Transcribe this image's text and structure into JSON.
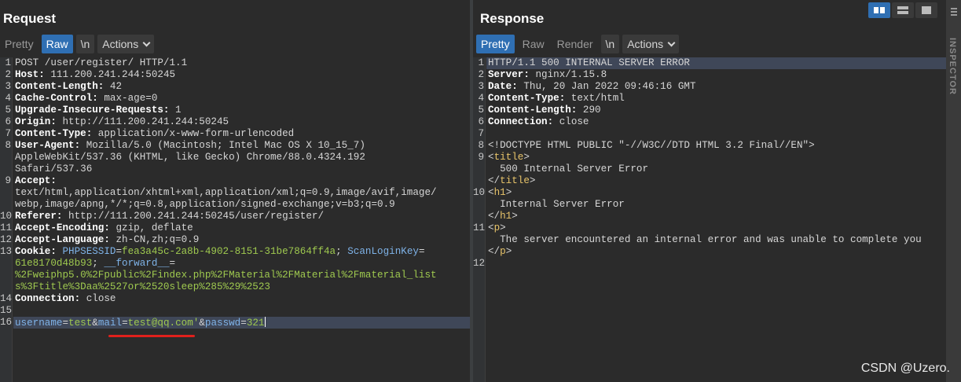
{
  "request": {
    "title": "Request",
    "toolbar": {
      "pretty": "Pretty",
      "raw": "Raw",
      "newline": "\\n",
      "actions": "Actions"
    },
    "lines": [
      {
        "n": "1",
        "segments": [
          {
            "t": "POST /user/register/ HTTP/1.1",
            "c": "v"
          }
        ]
      },
      {
        "n": "2",
        "segments": [
          {
            "t": "Host:",
            "c": "k"
          },
          {
            "t": " 111.200.241.244:50245",
            "c": "v"
          }
        ]
      },
      {
        "n": "3",
        "segments": [
          {
            "t": "Content-Length:",
            "c": "k"
          },
          {
            "t": " 42",
            "c": "v"
          }
        ]
      },
      {
        "n": "4",
        "segments": [
          {
            "t": "Cache-Control:",
            "c": "k"
          },
          {
            "t": " max-age=0",
            "c": "v"
          }
        ]
      },
      {
        "n": "5",
        "segments": [
          {
            "t": "Upgrade-Insecure-Requests:",
            "c": "k"
          },
          {
            "t": " 1",
            "c": "v"
          }
        ]
      },
      {
        "n": "6",
        "segments": [
          {
            "t": "Origin:",
            "c": "k"
          },
          {
            "t": " http://111.200.241.244:50245",
            "c": "v"
          }
        ]
      },
      {
        "n": "7",
        "segments": [
          {
            "t": "Content-Type:",
            "c": "k"
          },
          {
            "t": " application/x-www-form-urlencoded",
            "c": "v"
          }
        ]
      },
      {
        "n": "8",
        "segments": [
          {
            "t": "User-Agent:",
            "c": "k"
          },
          {
            "t": " Mozilla/5.0 (Macintosh; Intel Mac OS X 10_15_7)",
            "c": "v"
          }
        ]
      },
      {
        "n": "",
        "segments": [
          {
            "t": "AppleWebKit/537.36 (KHTML, like Gecko) Chrome/88.0.4324.192",
            "c": "v"
          }
        ]
      },
      {
        "n": "",
        "segments": [
          {
            "t": "Safari/537.36",
            "c": "v"
          }
        ]
      },
      {
        "n": "9",
        "segments": [
          {
            "t": "Accept:",
            "c": "k"
          }
        ]
      },
      {
        "n": "",
        "segments": [
          {
            "t": "text/html,application/xhtml+xml,application/xml;q=0.9,image/avif,image/",
            "c": "v"
          }
        ]
      },
      {
        "n": "",
        "segments": [
          {
            "t": "webp,image/apng,*/*;q=0.8,application/signed-exchange;v=b3;q=0.9",
            "c": "v"
          }
        ]
      },
      {
        "n": "10",
        "segments": [
          {
            "t": "Referer:",
            "c": "k"
          },
          {
            "t": " http://111.200.241.244:50245/user/register/",
            "c": "v"
          }
        ]
      },
      {
        "n": "11",
        "segments": [
          {
            "t": "Accept-Encoding:",
            "c": "k"
          },
          {
            "t": " gzip, deflate",
            "c": "v"
          }
        ]
      },
      {
        "n": "12",
        "segments": [
          {
            "t": "Accept-Language:",
            "c": "k"
          },
          {
            "t": " zh-CN,zh;q=0.9",
            "c": "v"
          }
        ]
      },
      {
        "n": "13",
        "segments": [
          {
            "t": "Cookie:",
            "c": "k"
          },
          {
            "t": " PHPSESSID",
            "c": "b"
          },
          {
            "t": "=",
            "c": "v"
          },
          {
            "t": "fea3a45c-2a8b-4902-8151-31be7864ff4a",
            "c": "g"
          },
          {
            "t": "; ",
            "c": "v"
          },
          {
            "t": "ScanLoginKey",
            "c": "b"
          },
          {
            "t": "=",
            "c": "v"
          }
        ]
      },
      {
        "n": "",
        "segments": [
          {
            "t": "61e8170d48b93",
            "c": "g"
          },
          {
            "t": "; ",
            "c": "v"
          },
          {
            "t": "__forward__",
            "c": "b"
          },
          {
            "t": "=",
            "c": "v"
          }
        ]
      },
      {
        "n": "",
        "segments": [
          {
            "t": "%2Fweiphp5.0%2Fpublic%2Findex.php%2FMaterial%2FMaterial%2Fmaterial_list",
            "c": "g"
          }
        ]
      },
      {
        "n": "",
        "segments": [
          {
            "t": "s%3Ftitle%3Daa%2527or%2520sleep%285%29%2523",
            "c": "g"
          }
        ]
      },
      {
        "n": "14",
        "segments": [
          {
            "t": "Connection:",
            "c": "k"
          },
          {
            "t": " close",
            "c": "v"
          }
        ]
      },
      {
        "n": "15",
        "segments": []
      },
      {
        "n": "16",
        "segments": [
          {
            "t": "username",
            "c": "b"
          },
          {
            "t": "=",
            "c": "v"
          },
          {
            "t": "test",
            "c": "g"
          },
          {
            "t": "&",
            "c": "v"
          },
          {
            "t": "mail",
            "c": "b"
          },
          {
            "t": "=",
            "c": "v"
          },
          {
            "t": "test@qq.com'",
            "c": "g"
          },
          {
            "t": "&",
            "c": "v"
          },
          {
            "t": "passwd",
            "c": "b"
          },
          {
            "t": "=",
            "c": "v"
          },
          {
            "t": "321",
            "c": "g"
          }
        ],
        "highlight": true,
        "cursor": true
      }
    ]
  },
  "response": {
    "title": "Response",
    "toolbar": {
      "pretty": "Pretty",
      "raw": "Raw",
      "render": "Render",
      "newline": "\\n",
      "actions": "Actions"
    },
    "lines": [
      {
        "n": "1",
        "segments": [
          {
            "t": "HTTP/1.1 500 INTERNAL SERVER ERROR",
            "c": "v"
          }
        ],
        "highlight": true
      },
      {
        "n": "2",
        "segments": [
          {
            "t": "Server:",
            "c": "k"
          },
          {
            "t": " nginx/1.15.8",
            "c": "v"
          }
        ]
      },
      {
        "n": "3",
        "segments": [
          {
            "t": "Date:",
            "c": "k"
          },
          {
            "t": " Thu, 20 Jan 2022 09:46:16 GMT",
            "c": "v"
          }
        ]
      },
      {
        "n": "4",
        "segments": [
          {
            "t": "Content-Type:",
            "c": "k"
          },
          {
            "t": " text/html",
            "c": "v"
          }
        ]
      },
      {
        "n": "5",
        "segments": [
          {
            "t": "Content-Length:",
            "c": "k"
          },
          {
            "t": " 290",
            "c": "v"
          }
        ]
      },
      {
        "n": "6",
        "segments": [
          {
            "t": "Connection:",
            "c": "k"
          },
          {
            "t": " close",
            "c": "v"
          }
        ]
      },
      {
        "n": "7",
        "segments": []
      },
      {
        "n": "8",
        "segments": [
          {
            "t": "<!DOCTYPE HTML PUBLIC \"-//W3C//DTD HTML 3.2 Final//EN\">",
            "c": "v"
          }
        ]
      },
      {
        "n": "9",
        "segments": [
          {
            "t": "<",
            "c": "v"
          },
          {
            "t": "title",
            "c": "t"
          },
          {
            "t": ">",
            "c": "v"
          }
        ]
      },
      {
        "n": "",
        "segments": [
          {
            "t": "  500 Internal Server Error",
            "c": "v"
          }
        ]
      },
      {
        "n": "",
        "segments": [
          {
            "t": "</",
            "c": "v"
          },
          {
            "t": "title",
            "c": "t"
          },
          {
            "t": ">",
            "c": "v"
          }
        ]
      },
      {
        "n": "10",
        "segments": [
          {
            "t": "<",
            "c": "v"
          },
          {
            "t": "h1",
            "c": "t"
          },
          {
            "t": ">",
            "c": "v"
          }
        ]
      },
      {
        "n": "",
        "segments": [
          {
            "t": "  Internal Server Error",
            "c": "v"
          }
        ]
      },
      {
        "n": "",
        "segments": [
          {
            "t": "</",
            "c": "v"
          },
          {
            "t": "h1",
            "c": "t"
          },
          {
            "t": ">",
            "c": "v"
          }
        ]
      },
      {
        "n": "11",
        "segments": [
          {
            "t": "<",
            "c": "v"
          },
          {
            "t": "p",
            "c": "t"
          },
          {
            "t": ">",
            "c": "v"
          }
        ]
      },
      {
        "n": "",
        "segments": [
          {
            "t": "  The server encountered an internal error and was unable to complete you",
            "c": "v"
          }
        ]
      },
      {
        "n": "",
        "segments": [
          {
            "t": "</",
            "c": "v"
          },
          {
            "t": "p",
            "c": "t"
          },
          {
            "t": ">",
            "c": "v"
          }
        ]
      },
      {
        "n": "12",
        "segments": []
      }
    ]
  },
  "inspector": {
    "label": "INSPECTOR"
  },
  "watermark": "CSDN @Uzero.",
  "colors": {
    "accent": "#2f6fb3",
    "underline": "#e0201c",
    "background": "#2b2b2b"
  }
}
